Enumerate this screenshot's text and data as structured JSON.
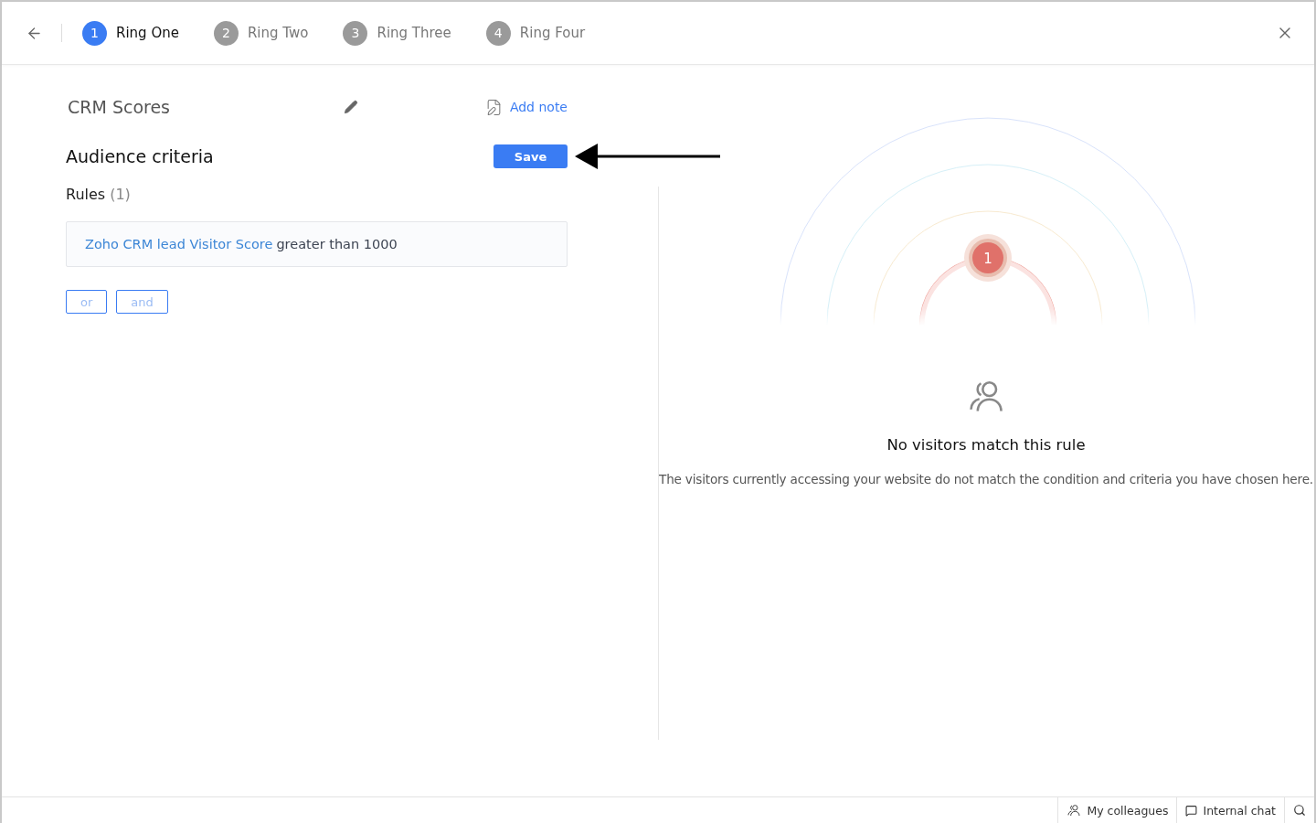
{
  "header": {
    "steps": [
      {
        "number": "1",
        "label": "Ring One",
        "selected": true
      },
      {
        "number": "2",
        "label": "Ring Two",
        "selected": false
      },
      {
        "number": "3",
        "label": "Ring Three",
        "selected": false
      },
      {
        "number": "4",
        "label": "Ring Four",
        "selected": false
      }
    ]
  },
  "editor": {
    "name": "CRM Scores",
    "add_note": "Add note",
    "section_title": "Audience criteria",
    "save": "Save",
    "rules_label": "Rules",
    "rules_count": "(1)",
    "rule": {
      "field": "Zoho CRM lead Visitor Score",
      "condition": "greater than 1000"
    },
    "connectors": [
      "or",
      "and"
    ]
  },
  "preview": {
    "badge": "1",
    "empty_title": "No visitors match this rule",
    "empty_text": "The visitors currently accessing your website do not match the condition and criteria you have chosen here."
  },
  "footer": [
    {
      "kind": "colleagues",
      "label": "My colleagues"
    },
    {
      "kind": "chat",
      "label": "Internal chat"
    }
  ]
}
